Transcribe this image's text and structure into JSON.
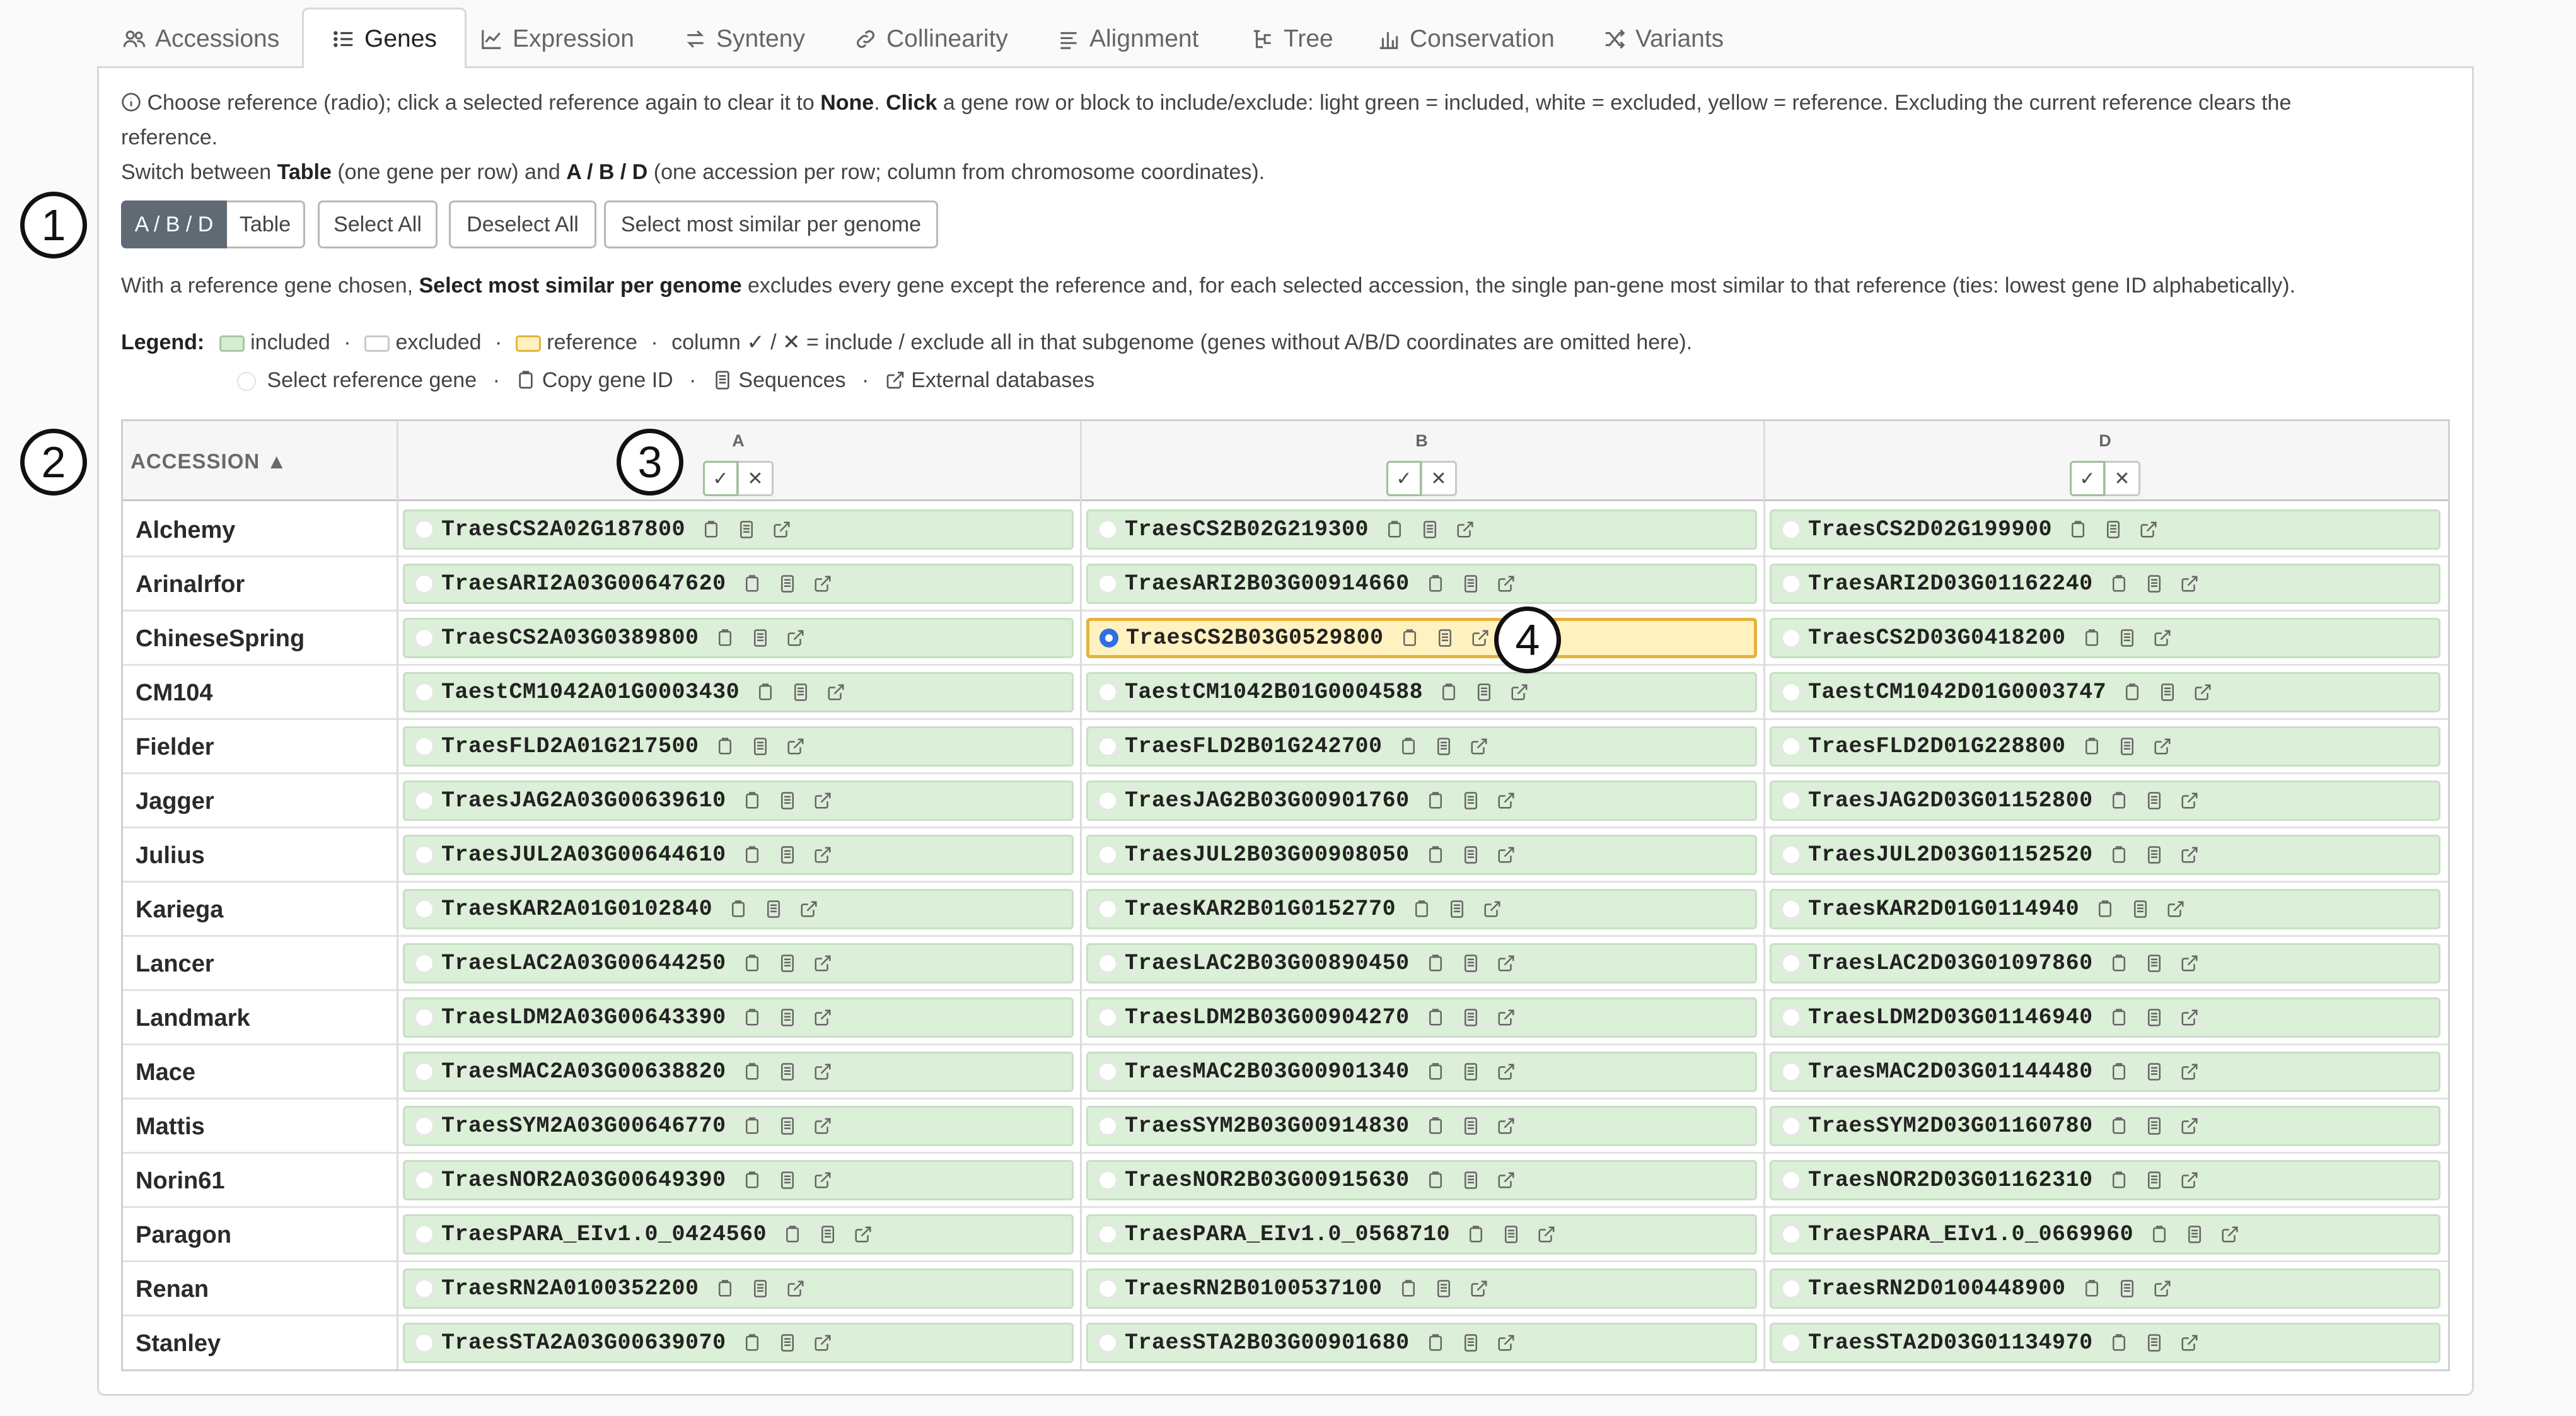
{
  "tabs": [
    {
      "label": "Accessions",
      "icon": "users-icon",
      "active": false
    },
    {
      "label": "Genes",
      "icon": "list-icon",
      "active": true
    },
    {
      "label": "Expression",
      "icon": "line-chart-icon",
      "active": false
    },
    {
      "label": "Synteny",
      "icon": "swap-icon",
      "active": false
    },
    {
      "label": "Collinearity",
      "icon": "link-icon",
      "active": false
    },
    {
      "label": "Alignment",
      "icon": "align-icon",
      "active": false
    },
    {
      "label": "Tree",
      "icon": "tree-icon",
      "active": false
    },
    {
      "label": "Conservation",
      "icon": "bar-chart-icon",
      "active": false
    },
    {
      "label": "Variants",
      "icon": "shuffle-icon",
      "active": false
    }
  ],
  "help": {
    "line1_a": "Choose reference (radio); click a selected reference again to clear it to ",
    "line1_b": "None",
    "line1_c": ". ",
    "line1_d": "Click",
    "line1_e": " a gene row or block to include/exclude: light green = included, white = excluded, yellow = reference. Excluding the current reference clears the",
    "line1_f": "reference.",
    "line2_a": "Switch between ",
    "line2_b": "Table",
    "line2_c": " (one gene per row) and ",
    "line2_d": "A / B / D",
    "line2_e": " (one accession per row; column from chromosome coordinates).",
    "line3_a": "With a reference gene chosen, ",
    "line3_b": "Select most similar per genome",
    "line3_c": " excludes every gene except the reference and, for each selected accession, the single pan-gene most similar to that reference (ties: lowest gene ID alphabetically)."
  },
  "buttons": {
    "abd": "A / B / D",
    "table": "Table",
    "select_all": "Select All",
    "deselect_all": "Deselect All",
    "most_similar": "Select most similar per genome"
  },
  "legend": {
    "title": "Legend:",
    "included": "included",
    "excluded": "excluded",
    "reference": "reference",
    "column_text": "column ✓ / ✕ = include / exclude all in that subgenome (genes without A/B/D coordinates are omitted here).",
    "select_ref": "Select reference gene",
    "copy": "Copy gene ID",
    "sequences": "Sequences",
    "external": "External databases",
    "sep": "·"
  },
  "table": {
    "accession_header": "ACCESSION ▲",
    "subgenomes": [
      "A",
      "B",
      "D"
    ],
    "check": "✓",
    "cross": "✕",
    "rows": [
      {
        "acc": "Alchemy",
        "genes": [
          "TraesCS2A02G187800",
          "TraesCS2B02G219300",
          "TraesCS2D02G199900"
        ]
      },
      {
        "acc": "Arinalrfor",
        "genes": [
          "TraesARI2A03G00647620",
          "TraesARI2B03G00914660",
          "TraesARI2D03G01162240"
        ]
      },
      {
        "acc": "ChineseSpring",
        "genes": [
          "TraesCS2A03G0389800",
          "TraesCS2B03G0529800",
          "TraesCS2D03G0418200"
        ]
      },
      {
        "acc": "CM104",
        "genes": [
          "TaestCM1042A01G0003430",
          "TaestCM1042B01G0004588",
          "TaestCM1042D01G0003747"
        ]
      },
      {
        "acc": "Fielder",
        "genes": [
          "TraesFLD2A01G217500",
          "TraesFLD2B01G242700",
          "TraesFLD2D01G228800"
        ]
      },
      {
        "acc": "Jagger",
        "genes": [
          "TraesJAG2A03G00639610",
          "TraesJAG2B03G00901760",
          "TraesJAG2D03G01152800"
        ]
      },
      {
        "acc": "Julius",
        "genes": [
          "TraesJUL2A03G00644610",
          "TraesJUL2B03G00908050",
          "TraesJUL2D03G01152520"
        ]
      },
      {
        "acc": "Kariega",
        "genes": [
          "TraesKAR2A01G0102840",
          "TraesKAR2B01G0152770",
          "TraesKAR2D01G0114940"
        ]
      },
      {
        "acc": "Lancer",
        "genes": [
          "TraesLAC2A03G00644250",
          "TraesLAC2B03G00890450",
          "TraesLAC2D03G01097860"
        ]
      },
      {
        "acc": "Landmark",
        "genes": [
          "TraesLDM2A03G00643390",
          "TraesLDM2B03G00904270",
          "TraesLDM2D03G01146940"
        ]
      },
      {
        "acc": "Mace",
        "genes": [
          "TraesMAC2A03G00638820",
          "TraesMAC2B03G00901340",
          "TraesMAC2D03G01144480"
        ]
      },
      {
        "acc": "Mattis",
        "genes": [
          "TraesSYM2A03G00646770",
          "TraesSYM2B03G00914830",
          "TraesSYM2D03G01160780"
        ]
      },
      {
        "acc": "Norin61",
        "genes": [
          "TraesNOR2A03G00649390",
          "TraesNOR2B03G00915630",
          "TraesNOR2D03G01162310"
        ]
      },
      {
        "acc": "Paragon",
        "genes": [
          "TraesPARA_EIv1.0_0424560",
          "TraesPARA_EIv1.0_0568710",
          "TraesPARA_EIv1.0_0669960"
        ]
      },
      {
        "acc": "Renan",
        "genes": [
          "TraesRN2A0100352200",
          "TraesRN2B0100537100",
          "TraesRN2D0100448900"
        ]
      },
      {
        "acc": "Stanley",
        "genes": [
          "TraesSTA2A03G00639070",
          "TraesSTA2B03G00901680",
          "TraesSTA2D03G01134970"
        ]
      }
    ],
    "reference": {
      "row": 2,
      "col": 1
    }
  },
  "markers": [
    "1",
    "2",
    "3",
    "4"
  ],
  "colors": {
    "included_bg": "#dcefd8",
    "reference_bg": "#fff1c0",
    "reference_border": "#e3b43c",
    "radio_selected": "#2f6fe0",
    "button_active": "#606a74"
  }
}
